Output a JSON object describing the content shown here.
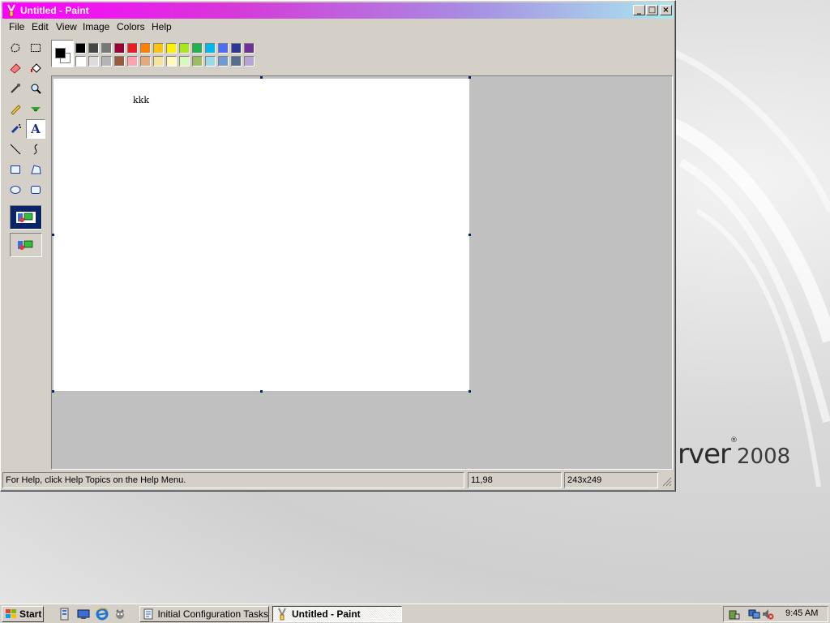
{
  "window": {
    "title": "Untitled - Paint",
    "controls": {
      "minimize": "_",
      "maximize": "□",
      "close": "×"
    }
  },
  "menubar": {
    "items": [
      {
        "label": "File"
      },
      {
        "label": "Edit"
      },
      {
        "label": "View"
      },
      {
        "label": "Image"
      },
      {
        "label": "Colors"
      },
      {
        "label": "Help"
      }
    ]
  },
  "toolbox": {
    "tools": [
      {
        "name": "free-form-select",
        "icon": "free-select-icon"
      },
      {
        "name": "select",
        "icon": "rect-select-icon"
      },
      {
        "name": "eraser",
        "icon": "eraser-icon"
      },
      {
        "name": "fill-with-color",
        "icon": "paint-bucket-icon"
      },
      {
        "name": "pick-color",
        "icon": "eyedropper-icon"
      },
      {
        "name": "magnifier",
        "icon": "magnifier-icon"
      },
      {
        "name": "pencil",
        "icon": "pencil-icon"
      },
      {
        "name": "brush",
        "icon": "brush-icon"
      },
      {
        "name": "airbrush",
        "icon": "airbrush-icon"
      },
      {
        "name": "text",
        "icon": "text-tool-icon",
        "glyph": "A"
      },
      {
        "name": "line",
        "icon": "line-icon"
      },
      {
        "name": "curve",
        "icon": "curve-icon"
      },
      {
        "name": "rectangle",
        "icon": "rectangle-icon"
      },
      {
        "name": "polygon",
        "icon": "polygon-icon"
      },
      {
        "name": "ellipse",
        "icon": "ellipse-icon"
      },
      {
        "name": "rounded-rectangle",
        "icon": "rounded-rect-icon"
      }
    ],
    "selected_tool": "text",
    "options": [
      "opaque-background-icon",
      "transparent-background-icon"
    ]
  },
  "palette": {
    "foreground": "#000000",
    "background": "#ffffff",
    "top_row": [
      "#000000",
      "#464646",
      "#787878",
      "#990030",
      "#ed1c24",
      "#ff7e00",
      "#ffc20e",
      "#fff200",
      "#a8e61d",
      "#22b14c",
      "#00b7ef",
      "#4d6df3",
      "#2f3699",
      "#6f3198"
    ],
    "bottom_row": [
      "#ffffff",
      "#dcdcdc",
      "#b4b4b4",
      "#9c5a3c",
      "#ffa3b1",
      "#e5aa7a",
      "#f5e49c",
      "#fff9bd",
      "#d3f9bc",
      "#9dbb61",
      "#99d9ea",
      "#709ad1",
      "#546d8e",
      "#b5a5d5"
    ]
  },
  "canvas": {
    "text": "kkk"
  },
  "statusbar": {
    "help": "For Help, click Help Topics on the Help Menu.",
    "cursor": "11,98",
    "size": "243x249"
  },
  "desktop": {
    "brand_text": "rver",
    "brand_mark": "®",
    "brand_year": "2008"
  },
  "taskbar": {
    "start_label": "Start",
    "quick_launch": [
      "server-manager-icon",
      "show-desktop-icon",
      "internet-explorer-icon",
      "windows-explorer-icon"
    ],
    "buttons": [
      {
        "label": "Initial Configuration Tasks",
        "icon": "config-tasks-icon",
        "active": false
      },
      {
        "label": "Untitled - Paint",
        "icon": "paint-icon",
        "active": true
      }
    ],
    "tray_icons": [
      "safely-remove-icon",
      "network-icon",
      "volume-icon"
    ],
    "clock": "9:45 AM"
  },
  "colors": {
    "title_gradient_start": "#ff00ff",
    "title_gradient_end": "#a8e8f0",
    "face": "#d4d0c8",
    "workspace": "#c0c0c0"
  }
}
